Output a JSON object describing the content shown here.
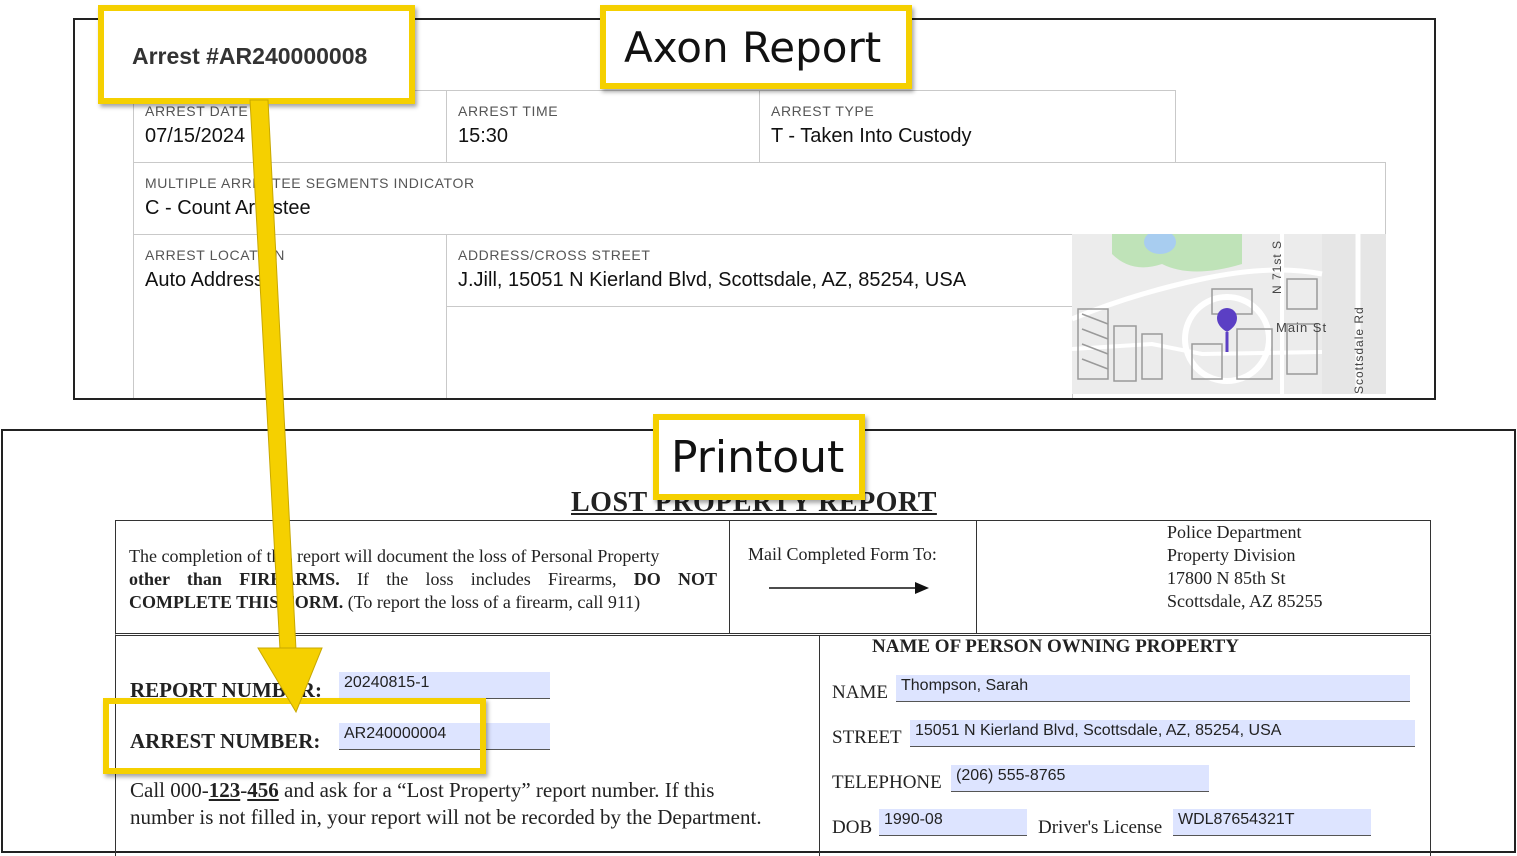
{
  "callouts": {
    "axon_label": "Axon Report",
    "printout_label": "Printout"
  },
  "axon": {
    "arrest_title": "Arrest #AR240000008",
    "fields": {
      "arrest_date": {
        "label": "ARREST DATE",
        "value": "07/15/2024"
      },
      "arrest_time": {
        "label": "ARREST TIME",
        "value": "15:30"
      },
      "arrest_type": {
        "label": "ARREST TYPE",
        "value": "T - Taken Into Custody"
      },
      "multiple": {
        "label": "MULTIPLE ARRESTEE SEGMENTS INDICATOR",
        "value": "C - Count Arrestee"
      },
      "location": {
        "label": "ARREST LOCATION",
        "value": "Auto Address"
      },
      "address": {
        "label": "ADDRESS/CROSS STREET",
        "value": "J.Jill, 15051 N Kierland Blvd, Scottsdale, AZ, 85254, USA"
      }
    },
    "map": {
      "street_n71": "N 71st S",
      "street_main": "Main St",
      "street_scottsdale": "Scottsdale Rd",
      "pin_color": "#5b3fc4"
    }
  },
  "printout": {
    "title": "LOST PROPERTY REPORT",
    "intro": {
      "line1": "The completion of this report will document the loss of Personal Property",
      "line2_bold": "other than FIREARMS.",
      "line2_rest": " If the loss includes Firearms, ",
      "line2_bold2": "DO NOT",
      "line3_bold": "COMPLETE THIS FORM.",
      "line3_rest": " (To report the loss of a firearm, call 911)"
    },
    "mail_label": "Mail Completed Form To:",
    "address_block": [
      "Police Department",
      "Property Division",
      "17800 N 85th St",
      "Scottsdale, AZ 85255"
    ],
    "report_number_label": "REPORT NUMBER:",
    "report_number_value": "20240815-1",
    "arrest_number_label": "ARREST NUMBER:",
    "arrest_number_value": "AR240000004",
    "call_text": {
      "prefix": "Call 000-",
      "mid": "123",
      "dash": "-",
      "end": "456",
      "suffix": " and ask for a “Lost Property” report number.  If this",
      "line2": "number is not filled in, your report will not be recorded by the Department."
    },
    "owner_heading": "NAME OF PERSON OWNING PROPERTY",
    "owner": {
      "name_label": "NAME",
      "name_value": "Thompson, Sarah",
      "street_label": "STREET",
      "street_value": "15051 N Kierland Blvd, Scottsdale, AZ, 85254, USA",
      "telephone_label": "TELEPHONE",
      "telephone_value": "(206) 555-8765",
      "dob_label": "DOB",
      "dob_value": "1990-08",
      "dl_label": "Driver's License",
      "dl_value": "WDL87654321T"
    }
  },
  "colors": {
    "highlight": "#f5d000",
    "fill_bg": "#dde4ff"
  }
}
